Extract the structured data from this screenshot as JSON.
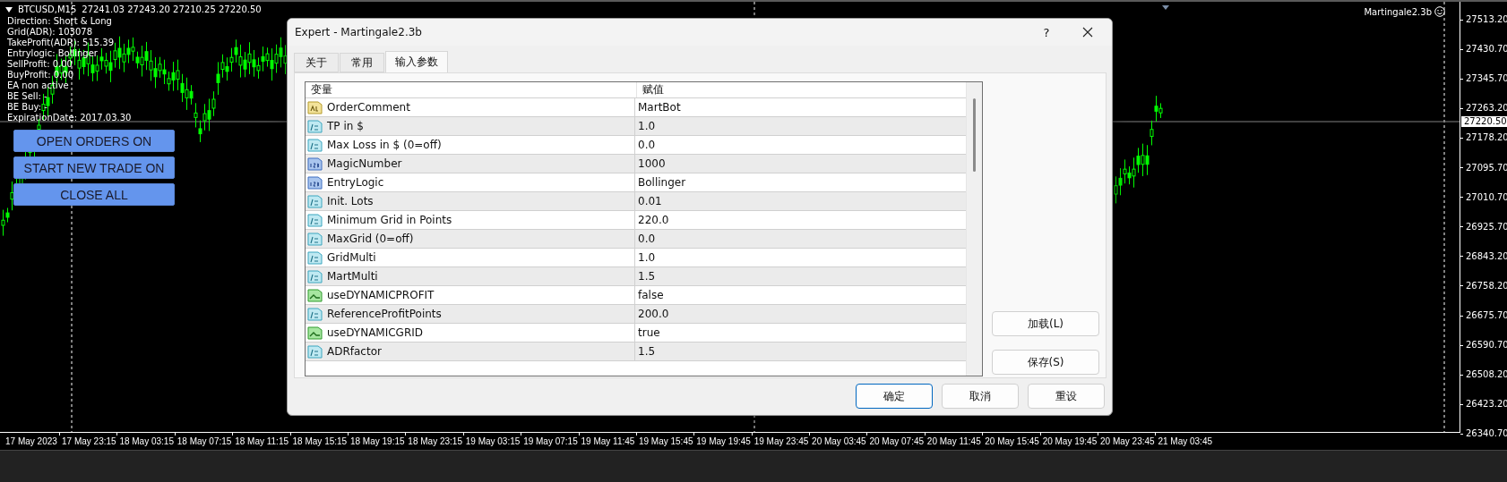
{
  "chart": {
    "symbol": "BTCUSD,M15",
    "ohlc": "27241.03 27243.20 27210.25 27220.50",
    "info_lines": [
      "Direction: Short & Long",
      "Grid(ADR): 103078",
      "TakeProfit(ADR): 515.39",
      "Entrylogic: Bollinger",
      "SellProfit: 0.00",
      "BuyProfit: 0.00",
      "EA non active",
      "BE Sell: -",
      "BE Buy: -",
      "ExpirationDate: 2017.03.30"
    ],
    "buttons": [
      "OPEN ORDERS ON",
      "START NEW TRADE ON",
      "CLOSE ALL"
    ],
    "expert_label": "Martingale2.3b"
  },
  "price_axis": {
    "labels": [
      "27513.20",
      "27430.70",
      "27345.70",
      "27263.20",
      "27178.20",
      "27095.70",
      "27010.70",
      "26925.70",
      "26843.20",
      "26758.20",
      "26675.70",
      "26590.70",
      "26508.20",
      "26423.20",
      "26340.70"
    ],
    "current_price": "27220.50"
  },
  "time_axis": {
    "labels": [
      "17 May 2023",
      "17 May 23:15",
      "18 May 03:15",
      "18 May 07:15",
      "18 May 11:15",
      "18 May 15:15",
      "18 May 19:15",
      "18 May 23:15",
      "19 May 03:15",
      "19 May 07:15",
      "19 May 11:45",
      "19 May 15:45",
      "19 May 19:45",
      "19 May 23:45",
      "20 May 03:45",
      "20 May 07:45",
      "20 May 11:45",
      "20 May 15:45",
      "20 May 19:45",
      "20 May 23:45",
      "21 May 03:45"
    ]
  },
  "dialog": {
    "title": "Expert - Martingale2.3b",
    "help": "?",
    "tabs": [
      {
        "label": "关于",
        "selected": false
      },
      {
        "label": "常用",
        "selected": false
      },
      {
        "label": "输入参数",
        "selected": true
      }
    ],
    "table": {
      "columns": [
        "变量",
        "赋值"
      ],
      "rows": [
        {
          "kind": "string",
          "name": "OrderComment",
          "value": "MartBot"
        },
        {
          "kind": "double",
          "name": "TP in $",
          "value": "1.0"
        },
        {
          "kind": "double",
          "name": "Max Loss in $ (0=off)",
          "value": "0.0"
        },
        {
          "kind": "int",
          "name": "MagicNumber",
          "value": "1000"
        },
        {
          "kind": "int",
          "name": "EntryLogic",
          "value": "Bollinger"
        },
        {
          "kind": "double",
          "name": "Init. Lots",
          "value": "0.01"
        },
        {
          "kind": "double",
          "name": "Minimum Grid in Points",
          "value": "220.0"
        },
        {
          "kind": "double",
          "name": "MaxGrid (0=off)",
          "value": "0.0"
        },
        {
          "kind": "double",
          "name": "GridMulti",
          "value": "1.0"
        },
        {
          "kind": "double",
          "name": "MartMulti",
          "value": "1.5"
        },
        {
          "kind": "bool",
          "name": "useDYNAMICPROFIT",
          "value": "false"
        },
        {
          "kind": "double",
          "name": "ReferenceProfitPoints",
          "value": "200.0"
        },
        {
          "kind": "bool",
          "name": "useDYNAMICGRID",
          "value": "true"
        },
        {
          "kind": "double",
          "name": "ADRfactor",
          "value": "1.5"
        }
      ]
    },
    "side_buttons": [
      "加载(L)",
      "保存(S)"
    ],
    "buttons": [
      {
        "label": "确定",
        "default": true
      },
      {
        "label": "取消",
        "default": false
      },
      {
        "label": "重设",
        "default": false
      }
    ]
  }
}
